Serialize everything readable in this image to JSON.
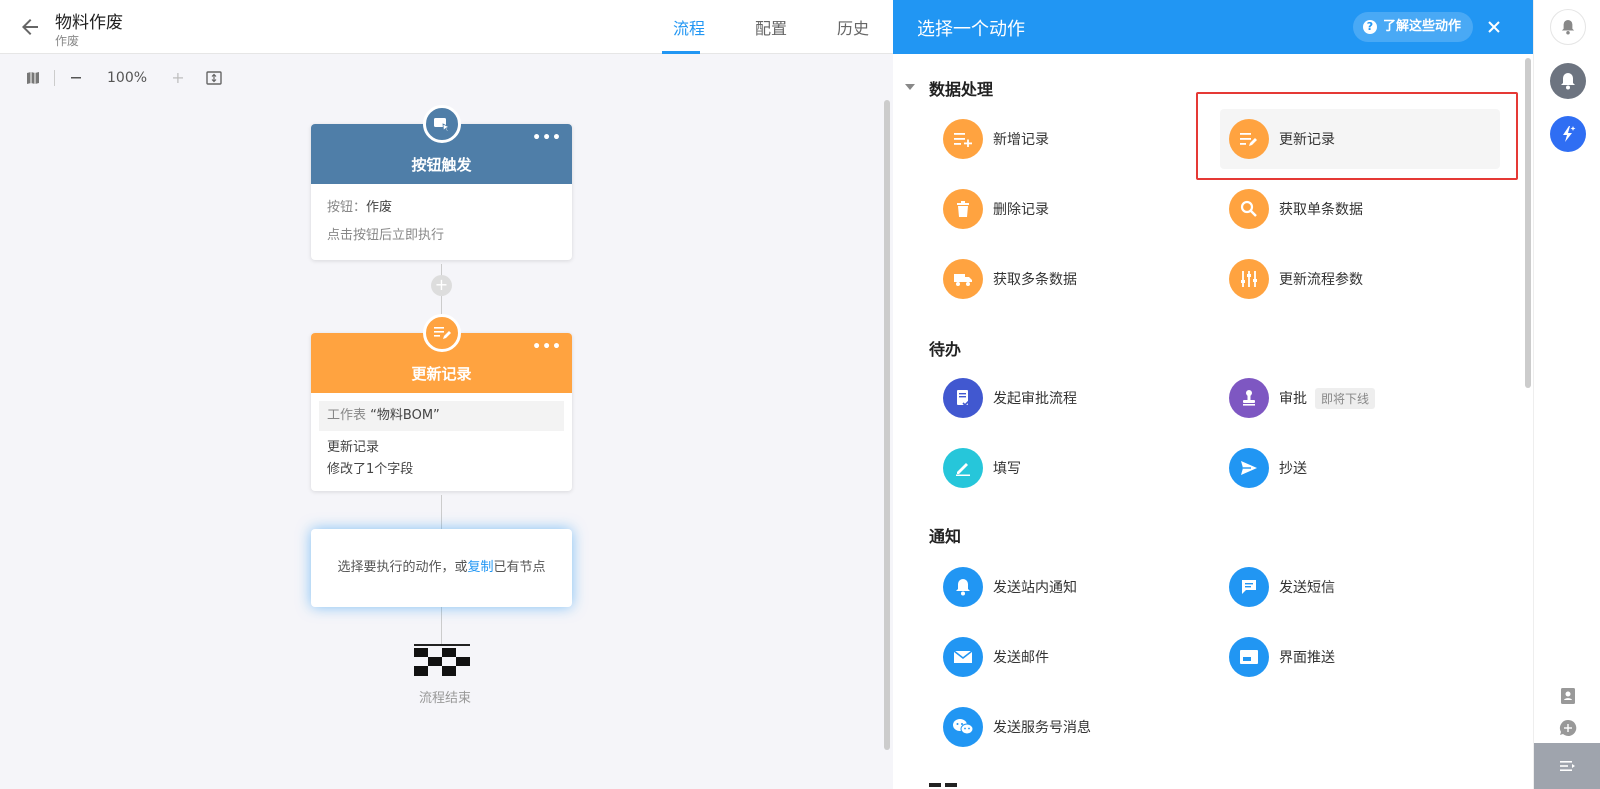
{
  "header": {
    "title": "物料作废",
    "subtitle": "作废",
    "tabs": [
      {
        "label": "流程",
        "active": true
      },
      {
        "label": "配置",
        "active": false
      },
      {
        "label": "历史",
        "active": false
      }
    ]
  },
  "canvas_toolbar": {
    "zoom": "100%"
  },
  "flow": {
    "trigger": {
      "title": "按钮触发",
      "color": "#4f7ea8",
      "button_label": "按钮：",
      "button_value": "作废",
      "description": "点击按钮后立即执行"
    },
    "update": {
      "title": "更新记录",
      "color": "#ffa340",
      "sheet_label": "工作表",
      "sheet_value": "“物料BOM”",
      "action": "更新记录",
      "detail": "修改了1个字段"
    },
    "select_node": {
      "text_before": "选择要执行的动作，或",
      "link": "复制",
      "text_after": "已有节点"
    },
    "end_label": "流程结束"
  },
  "panel": {
    "title": "选择一个动作",
    "learn_label": "了解这些动作",
    "sections": [
      {
        "title": "数据处理",
        "actions": [
          {
            "label": "新增记录",
            "icon": "add-record-icon",
            "color": "#ffa340"
          },
          {
            "label": "更新记录",
            "icon": "edit-record-icon",
            "color": "#ffa340"
          },
          {
            "label": "删除记录",
            "icon": "trash-icon",
            "color": "#ffa340"
          },
          {
            "label": "获取单条数据",
            "icon": "search-icon",
            "color": "#ffa340"
          },
          {
            "label": "获取多条数据",
            "icon": "truck-icon",
            "color": "#ffa340"
          },
          {
            "label": "更新流程参数",
            "icon": "sliders-icon",
            "color": "#ffa340"
          }
        ]
      },
      {
        "title": "待办",
        "actions": [
          {
            "label": "发起审批流程",
            "icon": "approval-doc-icon",
            "color": "#4158d0"
          },
          {
            "label": "审批",
            "icon": "stamp-icon",
            "color": "#7e57c2",
            "tag": "即将下线"
          },
          {
            "label": "填写",
            "icon": "pencil-icon",
            "color": "#26c6da"
          },
          {
            "label": "抄送",
            "icon": "send-icon",
            "color": "#2196f3"
          }
        ]
      },
      {
        "title": "通知",
        "actions": [
          {
            "label": "发送站内通知",
            "icon": "bell-icon",
            "color": "#2196f3"
          },
          {
            "label": "发送短信",
            "icon": "sms-icon",
            "color": "#2196f3"
          },
          {
            "label": "发送邮件",
            "icon": "mail-icon",
            "color": "#2196f3"
          },
          {
            "label": "界面推送",
            "icon": "screen-push-icon",
            "color": "#2196f3"
          },
          {
            "label": "发送服务号消息",
            "icon": "wechat-icon",
            "color": "#2196f3"
          }
        ]
      }
    ]
  }
}
